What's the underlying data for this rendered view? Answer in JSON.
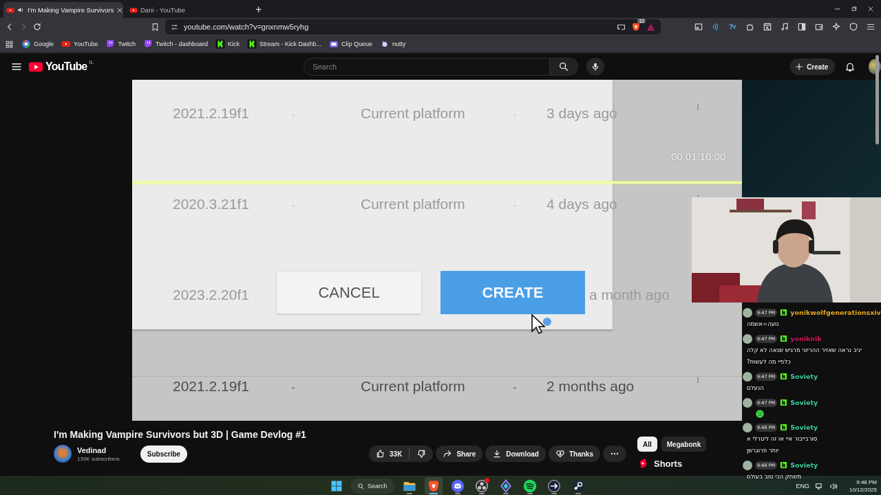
{
  "browser": {
    "tabs": [
      {
        "title": "I'm Making Vampire Survivors",
        "selected": true,
        "audio": true
      },
      {
        "title": "Dani - YouTube",
        "selected": false,
        "audio": false
      }
    ],
    "new_tab": "+",
    "url": "youtube.com/watch?v=gnxnmw5ryhg",
    "shields_count": "12",
    "bookmarks": [
      {
        "label": "Google",
        "kind": "google"
      },
      {
        "label": "YouTube",
        "kind": "youtube"
      },
      {
        "label": "Twitch",
        "kind": "twitch"
      },
      {
        "label": "Twitch - dashboard",
        "kind": "twitch"
      },
      {
        "label": "Kick",
        "kind": "kick"
      },
      {
        "label": "Stream - Kick Dashb...",
        "kind": "kick"
      },
      {
        "label": "Clip Queue",
        "kind": "tv"
      },
      {
        "label": "nutty",
        "kind": "dot"
      }
    ]
  },
  "youtube": {
    "logo": "YouTube",
    "region": "IL",
    "search": {
      "placeholder": "Search"
    },
    "create": "Create"
  },
  "video": {
    "timestamp": "00:01:10:00",
    "rows": [
      {
        "kind": "row",
        "version": "2021.2.19f1",
        "platform": "Current platform",
        "age": "3 days ago",
        "faded": true
      },
      {
        "kind": "row",
        "version": "2020.3.21f1",
        "platform": "Current platform",
        "age": "4 days ago",
        "faded": true
      },
      {
        "kind": "dialog",
        "version": "2023.2.20f1",
        "age": "a month ago",
        "faded": true
      },
      {
        "kind": "row",
        "version": "2021.2.19f1",
        "platform": "Current platform",
        "age": "2 months ago",
        "faded": false
      }
    ],
    "dialog": {
      "cancel": "CANCEL",
      "create": "CREATE"
    }
  },
  "details": {
    "title": "I'm Making Vampire Survivors but 3D | Game Devlog #1",
    "channel": "Vedinad",
    "subscribers": "139K subscribers",
    "subscribe": "Subscribe",
    "likes": "33K",
    "share": "Share",
    "download": "Download",
    "thanks": "Thanks"
  },
  "chips": [
    {
      "label": "All",
      "selected": true
    },
    {
      "label": "Megabonk",
      "selected": false
    }
  ],
  "shelf": "Shorts",
  "chat": [
    {
      "time": "9:47 PM",
      "user": "yonikwolfgenerationsxiv",
      "color": "#e5a823",
      "lines": [
        "נועה=אשמה"
      ]
    },
    {
      "time": "9:47 PM",
      "user": "yoniknik",
      "color": "#d2145a",
      "lines": [
        "יניב נראה שאזיר ההריוני מרגיש שנאה לא קלה",
        "כלפיי מה לעשות?"
      ]
    },
    {
      "time": "9:47 PM",
      "user": "Soviety",
      "color": "#3ccf9f",
      "lines": [
        "הנעלם"
      ]
    },
    {
      "time": "9:47 PM",
      "user": "Soviety",
      "color": "#3ccf9f",
      "kind": "emote"
    },
    {
      "time": "9:48 PM",
      "user": "Soviety",
      "color": "#3ccf9f",
      "lines": [
        "סורבייבור איי או זה ליטרלי א",
        "יותר פרוגרשן"
      ]
    },
    {
      "time": "9:48 PM",
      "user": "Soviety",
      "color": "#3ccf9f",
      "lines": [
        "משחק הכי טוב בעולם"
      ]
    }
  ],
  "taskbar": {
    "search": "Search",
    "apps": [
      {
        "kind": "explorer",
        "active": false
      },
      {
        "kind": "brave",
        "active": true
      },
      {
        "kind": "discord",
        "active": false
      },
      {
        "kind": "obs",
        "active": false,
        "badge": true
      },
      {
        "kind": "gem",
        "active": false
      },
      {
        "kind": "spotify",
        "active": false
      },
      {
        "kind": "arrow",
        "active": false
      },
      {
        "kind": "steam",
        "active": false
      }
    ],
    "language": "ENG",
    "time": "9:48 PM",
    "date": "10/12/2025"
  }
}
